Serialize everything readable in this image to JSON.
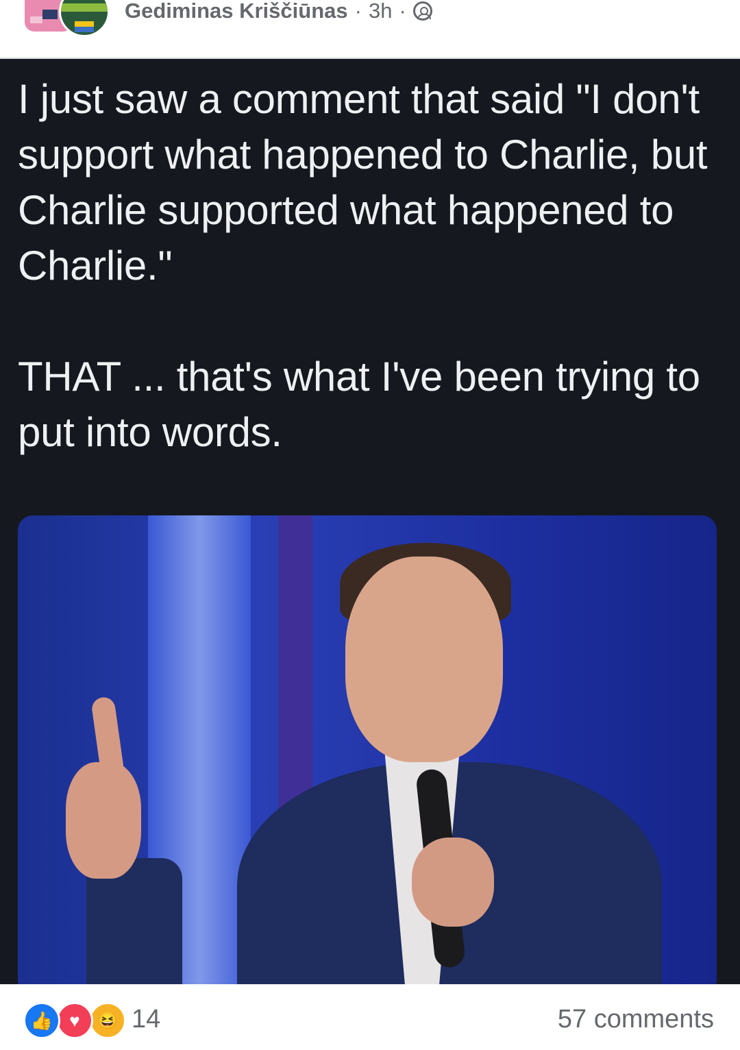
{
  "post": {
    "author_name": "Gediminas Kriščiūnas",
    "separator": "·",
    "time_ago": "3h",
    "privacy_icon": "friends-icon",
    "text_paragraphs": [
      "I just saw a comment that said \"I don't support what happened to Charlie, but Charlie supported what happened to Charlie.\"",
      "THAT ... that's what I've been trying to put into words."
    ],
    "colors": {
      "media_background": "#15191f",
      "media_text": "#eef0f2",
      "meta_text": "#65686c",
      "like_blue": "#1877f2",
      "love_red": "#f33e58",
      "haha_yellow": "#f7b125"
    }
  },
  "footer": {
    "reactions": [
      "like-icon",
      "love-icon",
      "haha-icon"
    ],
    "reaction_count": "14",
    "comments": "57 comments"
  }
}
